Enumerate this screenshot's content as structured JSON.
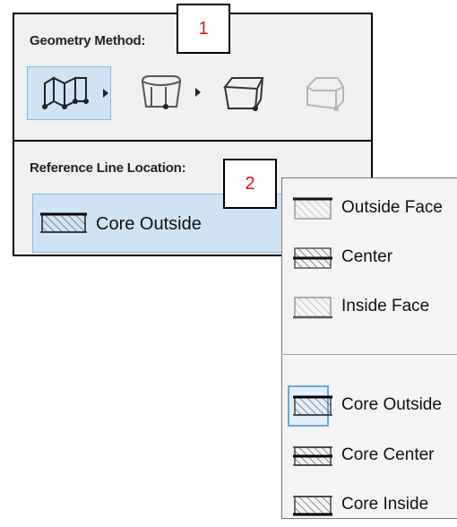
{
  "geometry": {
    "label": "Geometry Method:",
    "options": [
      {
        "icon": "straight-wall-icon",
        "selected": true
      },
      {
        "icon": "trapezoid-wall-icon",
        "selected": false
      },
      {
        "icon": "slanted-wall-icon",
        "selected": false
      },
      {
        "icon": "double-slanted-wall-icon",
        "selected": false,
        "disabled": true
      }
    ]
  },
  "reference_line": {
    "label": "Reference Line Location:",
    "value": "Core Outside"
  },
  "callouts": [
    "1",
    "2"
  ],
  "menu": {
    "items": [
      {
        "label": "Outside Face",
        "icon": "outside-face-icon"
      },
      {
        "label": "Center",
        "icon": "center-icon"
      },
      {
        "label": "Inside Face",
        "icon": "inside-face-icon"
      },
      {
        "label": "Core Outside",
        "icon": "core-outside-icon",
        "selected": true
      },
      {
        "label": "Core Center",
        "icon": "core-center-icon"
      },
      {
        "label": "Core Inside",
        "icon": "core-inside-icon"
      }
    ]
  },
  "colors": {
    "selected_bg": "#cfe3f5",
    "selected_border": "#8cb9e3",
    "callout_text": "#e01010"
  }
}
